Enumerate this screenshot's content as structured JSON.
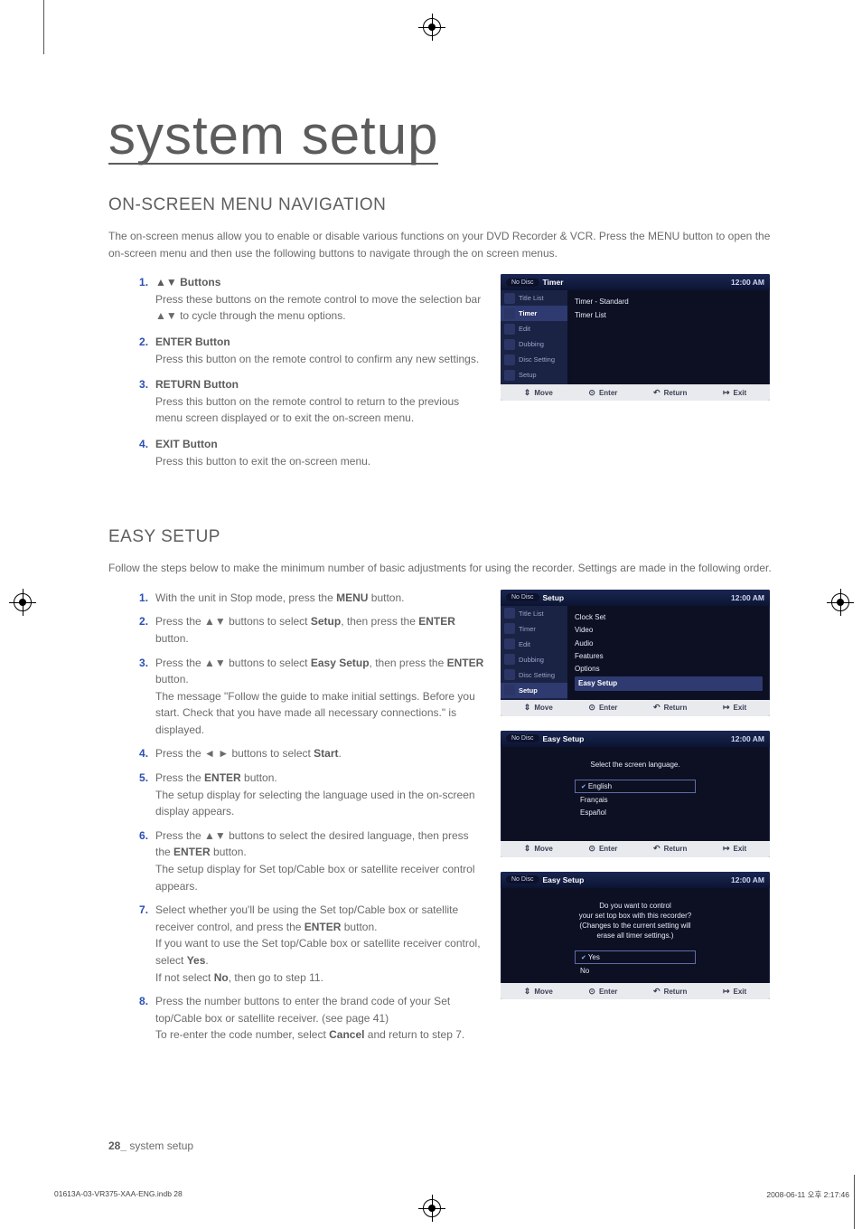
{
  "page": {
    "title": "system setup",
    "footer_num": "28_",
    "footer_text": "system setup",
    "print_left": "01613A-03-VR375-XAA-ENG.indb   28",
    "print_right": "2008-06-11   오후 2:17:46"
  },
  "section1": {
    "heading": "ON-SCREEN MENU NAVIGATION",
    "intro": "The on-screen menus allow you to enable or disable various functions on your DVD Recorder & VCR.\nPress the MENU button to open the on-screen menu and then use the following buttons to navigate through the on screen menus.",
    "items": [
      {
        "lead": "▲▼ Buttons",
        "body": "Press these buttons on the remote control to move the selection bar ▲▼ to cycle through the menu options."
      },
      {
        "lead": "ENTER Button",
        "body": "Press this button on the remote control to confirm any new settings."
      },
      {
        "lead": "RETURN Button",
        "body": "Press this button on the remote control to return to the previous menu screen displayed or to exit the on-screen menu."
      },
      {
        "lead": "EXIT Button",
        "body": "Press this button to exit the on-screen menu."
      }
    ]
  },
  "section2": {
    "heading": "EASY SETUP",
    "intro": "Follow the steps below to make the minimum number of basic adjustments for using the recorder.\nSettings are made in the following order.",
    "steps": [
      "With the unit in Stop mode, press the <b>MENU</b> button.",
      "Press the ▲▼ buttons to select <b>Setup</b>, then press the <b>ENTER</b> button.",
      "Press the ▲▼ buttons to select <b>Easy Setup</b>, then press the <b>ENTER</b> button.<br>The message \"Follow the guide to make initial settings. Before you start. Check that you have made all necessary connections.\" is displayed.",
      "Press the ◄ ► buttons to select <b>Start</b>.",
      "Press the <b>ENTER</b> button.<br>The setup display for selecting the language used in the on-screen display appears.",
      "Press the ▲▼ buttons to select the desired language, then press the <b>ENTER</b> button.<br>The setup display for Set top/Cable box or satellite receiver control appears.",
      "Select whether you'll be using the Set top/Cable box or satellite receiver control, and press the <b>ENTER</b> button.<br>If you want to use the Set top/Cable box or satellite receiver control, select <b>Yes</b>.<br>If not select <b>No</b>, then go to step 11.",
      "Press the number buttons to enter the brand code of your Set top/Cable box or satellite receiver. (see page 41)<br>To re-enter the code number, select <b>Cancel</b> and return to step 7."
    ]
  },
  "osd": {
    "nodisc": "No Disc",
    "clock": "12:00 AM",
    "footer": {
      "move": "Move",
      "enter": "Enter",
      "return": "Return",
      "exit": "Exit"
    },
    "side_items": [
      "Title List",
      "Timer",
      "Edit",
      "Dubbing",
      "Disc Setting",
      "Setup"
    ],
    "fig1": {
      "crumb": "Timer",
      "active_side": "Timer",
      "lines": [
        "Timer - Standard",
        "Timer List"
      ]
    },
    "fig2": {
      "crumb": "Setup",
      "active_side": "Setup",
      "lines": [
        "Clock Set",
        "Video",
        "Audio",
        "Features",
        "Options",
        "Easy Setup"
      ],
      "hl_index": 5
    },
    "fig3": {
      "crumb": "Easy Setup",
      "prompt": "Select the screen language.",
      "options": [
        "English",
        "Français",
        "Español"
      ],
      "selected": 0
    },
    "fig4": {
      "crumb": "Easy Setup",
      "prompt": "Do you want to control\nyour set top box with this recorder?\n(Changes to the current setting will\nerase all timer settings.)",
      "options": [
        "Yes",
        "No"
      ],
      "selected": 0
    }
  }
}
